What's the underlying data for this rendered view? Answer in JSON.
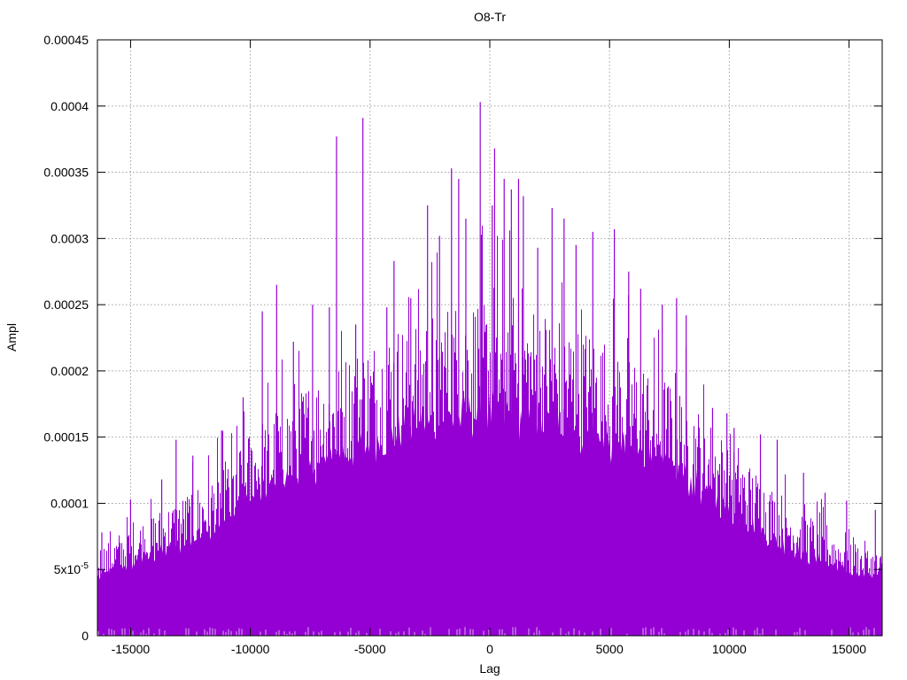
{
  "chart_data": {
    "type": "bar",
    "title": "O8-Tr",
    "xlabel": "Lag",
    "ylabel": "Ampl",
    "xlim": [
      -16384,
      16384
    ],
    "ylim": [
      0,
      0.00045
    ],
    "grid": true,
    "x_ticks": [
      {
        "value": -15000,
        "label": "-15000"
      },
      {
        "value": -10000,
        "label": "-10000"
      },
      {
        "value": -5000,
        "label": "-5000"
      },
      {
        "value": 0,
        "label": "0"
      },
      {
        "value": 5000,
        "label": "5000"
      },
      {
        "value": 10000,
        "label": "10000"
      },
      {
        "value": 15000,
        "label": "15000"
      }
    ],
    "y_ticks": [
      {
        "value": 0,
        "label": "0"
      },
      {
        "value": 5e-05,
        "label": "5x10",
        "sup": "-5"
      },
      {
        "value": 0.0001,
        "label": "0.0001"
      },
      {
        "value": 0.00015,
        "label": "0.00015"
      },
      {
        "value": 0.0002,
        "label": "0.0002"
      },
      {
        "value": 0.00025,
        "label": "0.00025"
      },
      {
        "value": 0.0003,
        "label": "0.0003"
      },
      {
        "value": 0.00035,
        "label": "0.00035"
      },
      {
        "value": 0.0004,
        "label": "0.0004"
      },
      {
        "value": 0.00045,
        "label": "0.00045"
      }
    ],
    "series": [
      {
        "color": "#9400d3",
        "envelope": {
          "x": [
            -16384,
            -15000,
            -13000,
            -11000,
            -10000,
            -8000,
            -6000,
            -4000,
            -2000,
            0,
            2000,
            4000,
            6000,
            8000,
            10000,
            12000,
            14000,
            16384
          ],
          "y": [
            6.5e-05,
            8e-05,
            0.0001,
            0.000125,
            0.00015,
            0.00018,
            0.000205,
            0.000225,
            0.00024,
            0.00025,
            0.00024,
            0.000225,
            0.000205,
            0.00018,
            0.00014,
            0.000105,
            8e-05,
            6e-05
          ]
        },
        "peaks": [
          {
            "x": -16200,
            "y": 7.8e-05
          },
          {
            "x": -15000,
            "y": 0.000103
          },
          {
            "x": -13700,
            "y": 0.000118
          },
          {
            "x": -13100,
            "y": 0.000148
          },
          {
            "x": -12400,
            "y": 0.000136
          },
          {
            "x": -11200,
            "y": 0.000155
          },
          {
            "x": -10300,
            "y": 0.00018
          },
          {
            "x": -9500,
            "y": 0.000245
          },
          {
            "x": -8900,
            "y": 0.000265
          },
          {
            "x": -8200,
            "y": 0.000222
          },
          {
            "x": -7400,
            "y": 0.00025
          },
          {
            "x": -6700,
            "y": 0.000248
          },
          {
            "x": -6400,
            "y": 0.000377
          },
          {
            "x": -5600,
            "y": 0.000235
          },
          {
            "x": -5300,
            "y": 0.000391
          },
          {
            "x": -4300,
            "y": 0.000248
          },
          {
            "x": -4000,
            "y": 0.000283
          },
          {
            "x": -3300,
            "y": 0.000255
          },
          {
            "x": -2600,
            "y": 0.000325
          },
          {
            "x": -2100,
            "y": 0.000302
          },
          {
            "x": -1600,
            "y": 0.000353
          },
          {
            "x": -1300,
            "y": 0.000345
          },
          {
            "x": -1000,
            "y": 0.000315
          },
          {
            "x": -400,
            "y": 0.000403
          },
          {
            "x": 100,
            "y": 0.000325
          },
          {
            "x": 200,
            "y": 0.000368
          },
          {
            "x": 600,
            "y": 0.000345
          },
          {
            "x": 900,
            "y": 0.000337
          },
          {
            "x": 1200,
            "y": 0.000345
          },
          {
            "x": 1400,
            "y": 0.000332
          },
          {
            "x": 2000,
            "y": 0.000293
          },
          {
            "x": 2600,
            "y": 0.000323
          },
          {
            "x": 3100,
            "y": 0.000315
          },
          {
            "x": 3600,
            "y": 0.000295
          },
          {
            "x": 4300,
            "y": 0.000305
          },
          {
            "x": 5200,
            "y": 0.000307
          },
          {
            "x": 5800,
            "y": 0.000275
          },
          {
            "x": 6300,
            "y": 0.000262
          },
          {
            "x": 7200,
            "y": 0.00025
          },
          {
            "x": 7800,
            "y": 0.000255
          },
          {
            "x": 8200,
            "y": 0.000242
          },
          {
            "x": 9300,
            "y": 0.000172
          },
          {
            "x": 9900,
            "y": 0.000168
          },
          {
            "x": 10200,
            "y": 0.000157
          },
          {
            "x": 11300,
            "y": 0.000152
          },
          {
            "x": 12000,
            "y": 0.000148
          },
          {
            "x": 13100,
            "y": 0.000123
          },
          {
            "x": 14000,
            "y": 0.000108
          },
          {
            "x": 14900,
            "y": 0.000102
          },
          {
            "x": 16100,
            "y": 9.5e-05
          }
        ]
      }
    ]
  }
}
